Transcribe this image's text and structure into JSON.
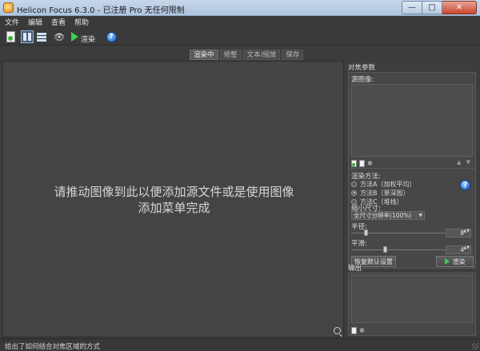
{
  "window": {
    "title": "Helicon Focus 6.3.0 - 已注册 Pro 无任何限制",
    "minimize_glyph": "—",
    "maximize_glyph": "□",
    "close_glyph": "✕"
  },
  "menu": {
    "items": [
      "文件",
      "编辑",
      "查看",
      "帮助"
    ]
  },
  "toolbar": {
    "render_label": "渲染",
    "help_glyph": "?",
    "icons": [
      "add-images-icon",
      "split-view-icon",
      "stack-view-icon",
      "preview-eye-icon",
      "render-play-icon",
      "help-icon"
    ]
  },
  "tabs": [
    {
      "label": "渲染中",
      "active": true
    },
    {
      "label": "修整",
      "active": false
    },
    {
      "label": "文本/缩放",
      "active": false
    },
    {
      "label": "保存",
      "active": false
    }
  ],
  "canvas": {
    "hint_line1": "请推动图像到此以便添加源文件或是使用图像",
    "hint_line2": "添加菜单完成"
  },
  "panel": {
    "title": "对焦参数",
    "source_label": "源图像:",
    "list_arrows": "▲ ▼",
    "method_label": "渲染方法:",
    "methods": [
      {
        "label": "方法A（加权平均）",
        "selected": false
      },
      {
        "label": "方法B（景深图）",
        "selected": true
      },
      {
        "label": "方法C（堆栈）",
        "selected": false
      }
    ],
    "size_label": "缩小尺寸:",
    "size_value": "全尺寸分辨率(100%)",
    "select_caret": "▼",
    "radius_label": "半径:",
    "radius_value": "8",
    "radius_fraction": 0.14,
    "smooth_label": "平滑:",
    "smooth_value": "4",
    "smooth_fraction": 0.35,
    "spin_arrows": "▲▼",
    "reset_button": "恢复默认设置",
    "render_button": "渲染",
    "output_label": "输出"
  },
  "statusbar": {
    "message": "给出了如何结合对焦区域的方式"
  }
}
